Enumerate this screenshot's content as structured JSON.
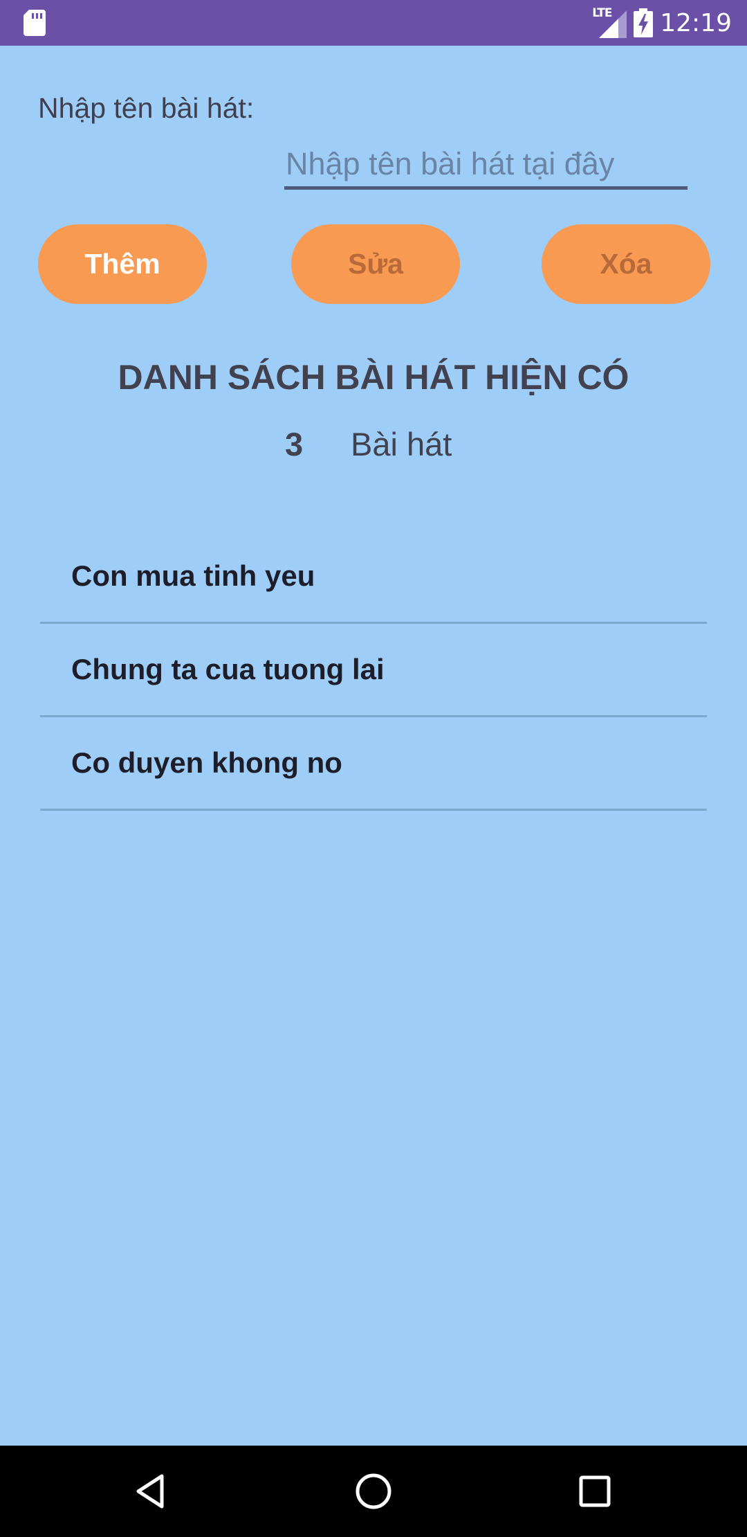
{
  "status_bar": {
    "network": "LTE",
    "time": "12:19",
    "icons": [
      "sd-card-icon",
      "signal-icon",
      "battery-charging-icon"
    ]
  },
  "form": {
    "label": "Nhập tên bài hát:",
    "input_value": "",
    "input_placeholder": "Nhập tên bài hát tại đây"
  },
  "buttons": {
    "add": "Thêm",
    "edit": "Sửa",
    "delete": "Xóa"
  },
  "list": {
    "title": "DANH SÁCH BÀI HÁT HIỆN CÓ",
    "count": "3",
    "count_label": "Bài hát",
    "items": [
      {
        "name": "Con mua tinh yeu"
      },
      {
        "name": "Chung ta cua tuong lai"
      },
      {
        "name": "Co duyen khong no"
      }
    ]
  },
  "nav_bar": {
    "icons": [
      "back-icon",
      "home-icon",
      "recents-icon"
    ]
  },
  "colors": {
    "status_bar": "#6a50a7",
    "background": "#9ecef8",
    "button": "#f89a52",
    "nav_bar": "#000000"
  }
}
